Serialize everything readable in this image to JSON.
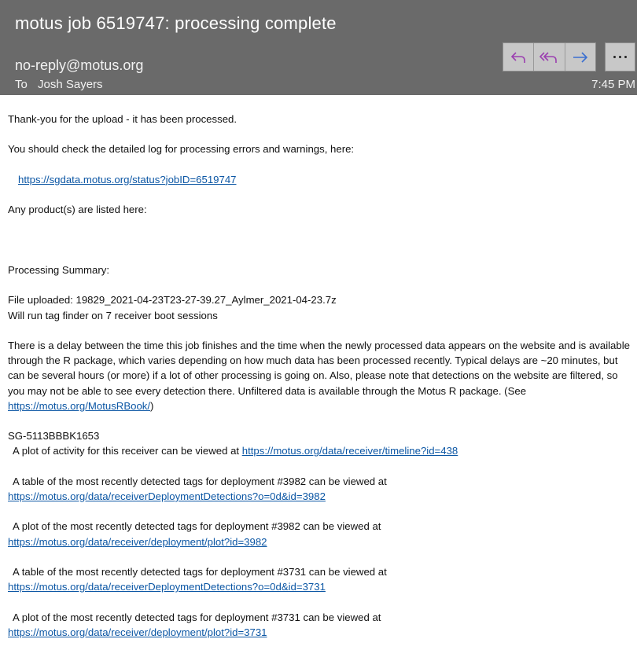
{
  "header": {
    "subject": "motus job 6519747: processing complete",
    "from": "no-reply@motus.org",
    "to_label": "To",
    "to_name": "Josh Sayers",
    "time": "7:45 PM",
    "buttons": [
      "reply-icon",
      "reply-all-icon",
      "forward-icon",
      "more-icon"
    ]
  },
  "body": {
    "p1": "Thank-you for the upload - it has been processed.",
    "p2": "You should check the detailed log for processing errors and warnings, here:",
    "status_link": "https://sgdata.motus.org/status?jobID=6519747",
    "p3": "Any product(s) are listed here:",
    "summary_title": "Processing Summary:",
    "file_uploaded": "File uploaded: 19829_2021-04-23T23-27-39.27_Aylmer_2021-04-23.7z",
    "tag_finder": "Will run tag finder on 7 receiver boot sessions",
    "delay_text": "There is a delay between the time this job finishes and the time when the newly processed data appears on the website and is available through the R package, which varies depending on how much data has been processed recently. Typical delays are ~20 minutes, but can be several hours (or more) if a lot of other processing is going on. Also, please note that detections on the website are filtered, so you may not be able to see every detection there. Unfiltered data is available through the Motus R package. (See ",
    "rbook_link": "https://motus.org/MotusRBook/",
    "delay_close": ")",
    "receiver_id": "SG-5113BBBK1653",
    "activity_text": "A plot of activity for this receiver can be viewed at ",
    "activity_link": "https://motus.org/data/receiver/timeline?id=438",
    "t3982_text": "A table of the most recently detected tags for deployment #3982 can be viewed at",
    "t3982_link": "https://motus.org/data/receiverDeploymentDetections?o=0d&id=3982",
    "p3982_text": "A plot of the most recently detected tags for deployment #3982 can be viewed at",
    "p3982_link": "https://motus.org/data/receiver/deployment/plot?id=3982",
    "t3731_text": "A table of the most recently detected tags for deployment #3731 can be viewed at",
    "t3731_link": "https://motus.org/data/receiverDeploymentDetections?o=0d&id=3731",
    "p3731_text": "A plot of the most recently detected tags for deployment #3731 can be viewed at",
    "p3731_link": "https://motus.org/data/receiver/deployment/plot?id=3731"
  },
  "colors": {
    "header_bg": "#6a6a6a",
    "button_bg": "#c8c8c8",
    "reply_icon": "#9b3fb0",
    "forward_icon": "#3a6fd0",
    "link": "#0b56a4"
  }
}
